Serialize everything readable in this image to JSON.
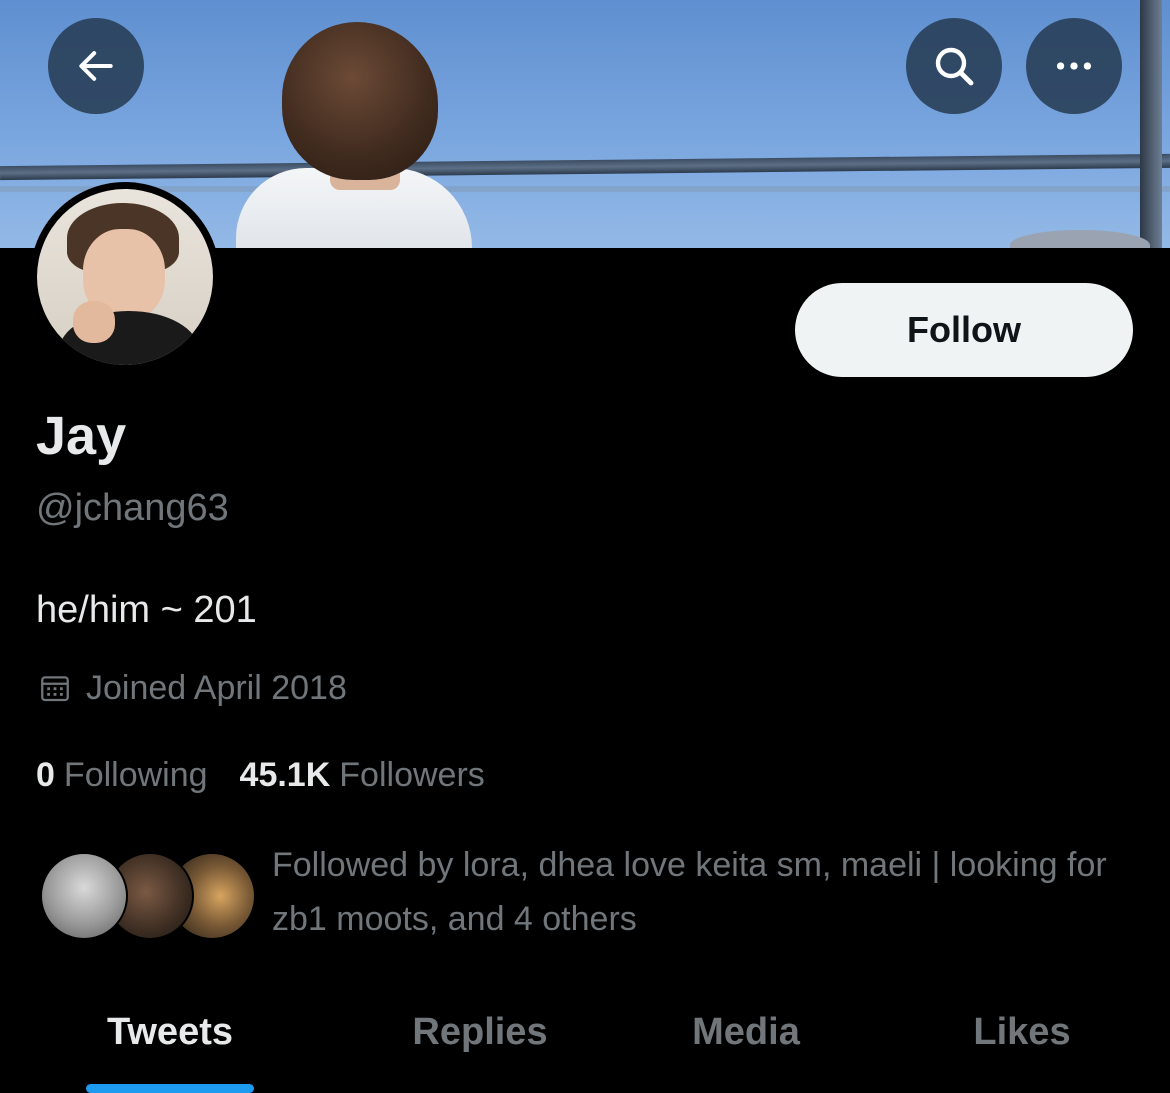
{
  "header": {
    "icons": {
      "back": "back-arrow-icon",
      "search": "search-icon",
      "more": "more-icon"
    }
  },
  "profile": {
    "display_name": "Jay",
    "handle": "@jchang63",
    "bio": "he/him ~ 201",
    "joined": "Joined April 2018",
    "follow_label": "Follow"
  },
  "stats": {
    "following_count": "0",
    "following_label": "Following",
    "followers_count": "45.1K",
    "followers_label": "Followers"
  },
  "followed_by": {
    "text": "Followed by lora, dhea love keita sm, maeli | looking for zb1 moots, and 4 others"
  },
  "tabs": [
    {
      "label": "Tweets",
      "active": true
    },
    {
      "label": "Replies",
      "active": false
    },
    {
      "label": "Media",
      "active": false
    },
    {
      "label": "Likes",
      "active": false
    }
  ],
  "colors": {
    "accent": "#1d9bf0",
    "background": "#000000",
    "primary_text": "#e7e9ea",
    "secondary_text": "#71767b",
    "follow_button_bg": "#eff3f4"
  }
}
